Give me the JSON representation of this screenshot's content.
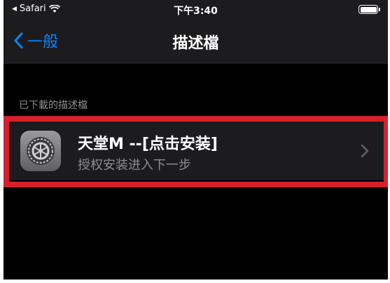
{
  "status_bar": {
    "carrier": "Safari",
    "time": "下午3:40"
  },
  "nav_bar": {
    "back_label": "一般",
    "title": "描述檔"
  },
  "section": {
    "header": "已下載的描述檔"
  },
  "profile": {
    "title": "天堂M --[点击安装]",
    "subtitle": "授权安装进入下一步",
    "icon": "settings-gear-icon"
  },
  "colors": {
    "accent": "#0a84ff",
    "highlight_border": "#d6202b",
    "background": "#000000",
    "cell_background": "#1c1c1e"
  }
}
